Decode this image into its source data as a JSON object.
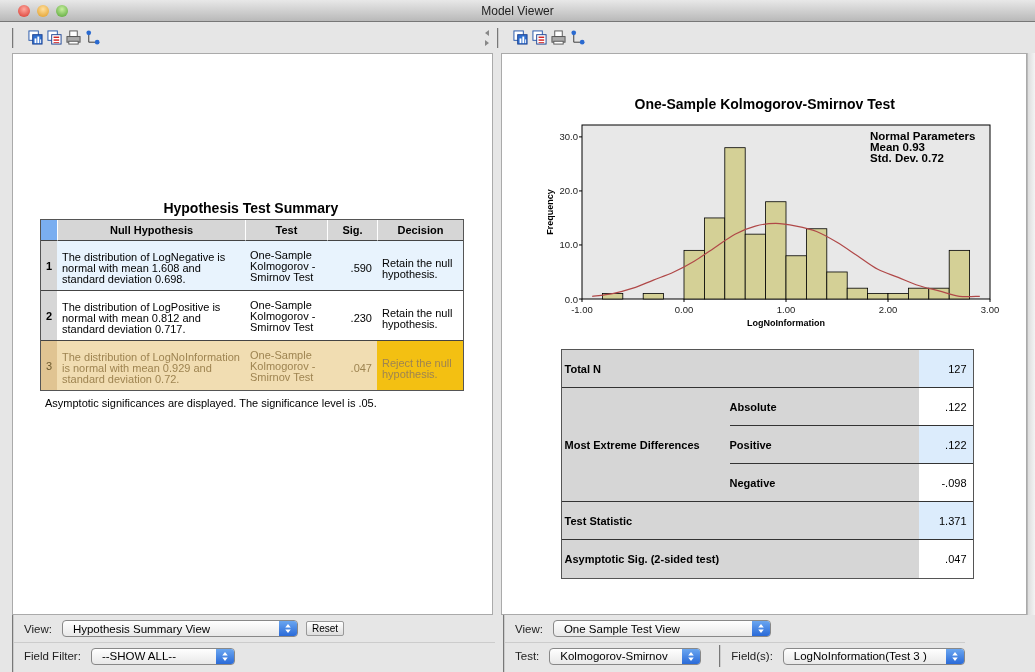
{
  "window": {
    "title": "Model Viewer"
  },
  "left_panel": {
    "title": "Hypothesis Test Summary",
    "columns": [
      "Null Hypothesis",
      "Test",
      "Sig.",
      "Decision"
    ],
    "rows": [
      {
        "index": "1",
        "hypothesis": "The distribution of LogNegative is normal with mean 1.608 and standard deviation 0.698.",
        "test": "One-Sample Kolmogorov -Smirnov Test",
        "sig": ".590",
        "decision": "Retain the null hypothesis.",
        "selected": false,
        "shaded": true,
        "reject": false
      },
      {
        "index": "2",
        "hypothesis": "The distribution of LogPositive is normal with mean 0.812 and standard deviation 0.717.",
        "test": "One-Sample Kolmogorov -Smirnov Test",
        "sig": ".230",
        "decision": "Retain the null hypothesis.",
        "selected": false,
        "shaded": false,
        "reject": false
      },
      {
        "index": "3",
        "hypothesis": "The distribution of LogNoInformation is normal with mean 0.929 and standard deviation 0.72.",
        "test": "One-Sample Kolmogorov -Smirnov Test",
        "sig": ".047",
        "decision": "Reject the null hypothesis.",
        "selected": true,
        "shaded": false,
        "reject": true
      }
    ],
    "note": "Asymptotic significances are displayed.  The significance level is .05."
  },
  "right_panel": {
    "title": "One-Sample Kolmogorov-Smirnov Test",
    "legend": [
      "Normal Parameters",
      "Mean 0.93",
      "Std. Dev. 0.72"
    ],
    "chart_data": {
      "type": "bar",
      "xlabel": "LogNoInformation",
      "ylabel": "Frequency",
      "x": [
        -0.9,
        -0.7,
        -0.5,
        -0.3,
        -0.1,
        0.1,
        0.3,
        0.5,
        0.7,
        0.9,
        1.1,
        1.3,
        1.5,
        1.7,
        1.9,
        2.1,
        2.3,
        2.5,
        2.7,
        2.9
      ],
      "series": [
        {
          "color": "#d4d096",
          "values": [
            0,
            1,
            0,
            1,
            0,
            9,
            15,
            28,
            12,
            18,
            8,
            13,
            5,
            2,
            1,
            1,
            2,
            2,
            9,
            0
          ]
        },
        {
          "type": "line",
          "color": "#b04848",
          "values": [
            0.5,
            1,
            2,
            3.5,
            5,
            7,
            9.5,
            12,
            13.5,
            14,
            13.5,
            12.5,
            10.5,
            8,
            5.5,
            4,
            2.5,
            1.5,
            0.5,
            0.5
          ]
        }
      ],
      "xlim": [
        -1,
        3
      ],
      "ylim": [
        0,
        32.2
      ],
      "xticks": [
        {
          "value": -1,
          "label": "-1.00"
        },
        {
          "value": 0,
          "label": "0.00"
        },
        {
          "value": 1,
          "label": "1.00"
        },
        {
          "value": 2,
          "label": "2.00"
        },
        {
          "value": 3,
          "label": "3.00"
        }
      ],
      "yticks": [
        {
          "value": 0,
          "label": "0.0"
        },
        {
          "value": 10,
          "label": "10.0"
        },
        {
          "value": 20,
          "label": "20.0"
        },
        {
          "value": 30,
          "label": "30.0"
        }
      ]
    },
    "stats": [
      {
        "label": "Total N",
        "value": "127",
        "highlighted": true
      },
      {
        "label": "Most Extreme Differences",
        "children": [
          {
            "label": "Absolute",
            "value": ".122",
            "highlighted": false
          },
          {
            "label": "Positive",
            "value": ".122",
            "highlighted": true
          },
          {
            "label": "Negative",
            "value": "-.098",
            "highlighted": false
          }
        ]
      },
      {
        "label": "Test Statistic",
        "value": "1.371",
        "highlighted": true
      },
      {
        "label": "Asymptotic Sig. (2-sided test)",
        "value": ".047",
        "highlighted": false
      }
    ]
  },
  "left_controls": {
    "view_label": "View:",
    "view_value": "Hypothesis Summary View",
    "reset": "Reset",
    "filter_label": "Field Filter:",
    "filter_value": "--SHOW ALL--"
  },
  "right_controls": {
    "view_label": "View:",
    "view_value": "One Sample Test View",
    "test_label": "Test:",
    "test_value": "Kolmogorov-Smirnov",
    "fields_label": "Field(s):",
    "fields_value": "LogNoInformation(Test 3 )"
  }
}
